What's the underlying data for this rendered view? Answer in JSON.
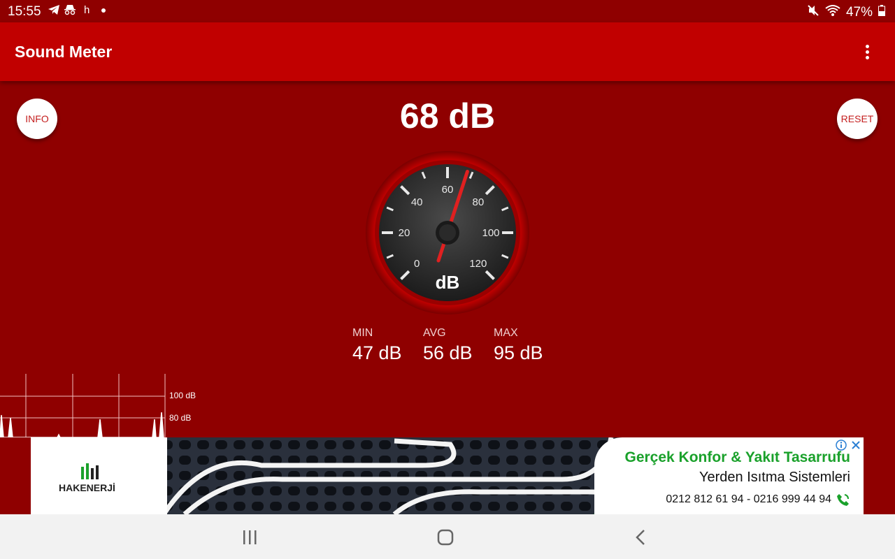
{
  "status_bar": {
    "time": "15:55",
    "notification_icons": [
      "telegram-icon",
      "incognito-icon",
      "h-icon",
      "dot-icon"
    ],
    "battery": "47%",
    "right_icons": [
      "mute-icon",
      "wifi-icon",
      "battery-icon"
    ]
  },
  "app_bar": {
    "title": "Sound Meter",
    "menu_icon": "more-vert-icon"
  },
  "buttons": {
    "info": "INFO",
    "reset": "RESET"
  },
  "reading": "68 dB",
  "gauge": {
    "unit": "dB",
    "ticks": [
      "0",
      "20",
      "40",
      "60",
      "80",
      "100",
      "120"
    ],
    "value": 68,
    "colors": {
      "rim": "#b00000",
      "face": "#333333",
      "needle": "#e02020"
    }
  },
  "stats": {
    "min": {
      "label": "MIN",
      "value": "47 dB"
    },
    "avg": {
      "label": "AVG",
      "value": "56 dB"
    },
    "max": {
      "label": "MAX",
      "value": "95 dB"
    }
  },
  "graph": {
    "labels": [
      "100 dB",
      "80 dB"
    ]
  },
  "ad": {
    "brand": "HAKENERJİ",
    "headline": "Gerçek Konfor & Yakıt Tasarrufu",
    "subline": "Yerden Isıtma Sistemleri",
    "phone": "0212 812 61 94 - 0216 999 44 94",
    "icons": [
      "adchoices-icon",
      "close-icon",
      "phone-icon"
    ]
  },
  "nav_bar": {
    "icons": [
      "recent-apps-icon",
      "home-icon",
      "back-icon"
    ]
  }
}
